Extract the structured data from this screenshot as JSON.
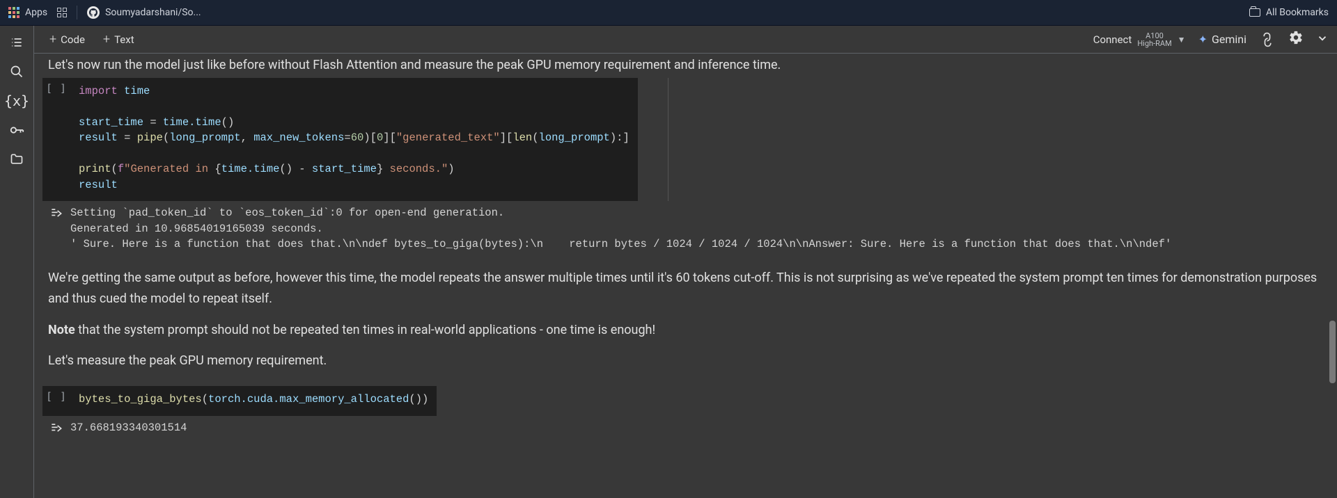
{
  "bookmarks": {
    "apps_label": "Apps",
    "repo_label": "Soumyadarshani/So...",
    "all_bookmarks_label": "All Bookmarks"
  },
  "toolbar": {
    "code_label": "Code",
    "text_label": "Text",
    "connect_label": "Connect",
    "hw_line1": "A100",
    "hw_line2": "High-RAM",
    "gemini_label": "Gemini"
  },
  "truncated_line": "Let's now run the model just like before without Flash Attention and measure the peak GPU memory requirement and inference time.",
  "cell1": {
    "prompt": "[ ]",
    "tokens": {
      "import": "import",
      "time": "time",
      "start_time": "start_time",
      "eq": " = ",
      "time_time": "time.time",
      "result": "result",
      "pipe": "pipe",
      "long_prompt": "long_prompt",
      "mnt": "max_new_tokens",
      "sixty": "60",
      "zero": "0",
      "gen_text": "\"generated_text\"",
      "len": "len",
      "print": "print",
      "fq": "f",
      "str1": "\"Generated in ",
      "str2": " seconds.\""
    },
    "output": "Setting `pad_token_id` to `eos_token_id`:0 for open-end generation.\nGenerated in 10.96854019165039 seconds.\n' Sure. Here is a function that does that.\\n\\ndef bytes_to_giga(bytes):\\n    return bytes / 1024 / 1024 / 1024\\n\\nAnswer: Sure. Here is a function that does that.\\n\\ndef'"
  },
  "md1": {
    "p1": "We're getting the same output as before, however this time, the model repeats the answer multiple times until it's 60 tokens cut-off. This is not surprising as we've repeated the system prompt ten times for demonstration purposes and thus cued the model to repeat itself.",
    "p2_strong": "Note",
    "p2_rest": " that the system prompt should not be repeated ten times in real-world applications - one time is enough!",
    "p3": "Let's measure the peak GPU memory requirement."
  },
  "cell2": {
    "prompt": "[ ]",
    "tokens": {
      "fn": "bytes_to_giga_bytes",
      "torch": "torch.cuda.max_memory_allocated"
    },
    "output": "37.668193340301514"
  }
}
